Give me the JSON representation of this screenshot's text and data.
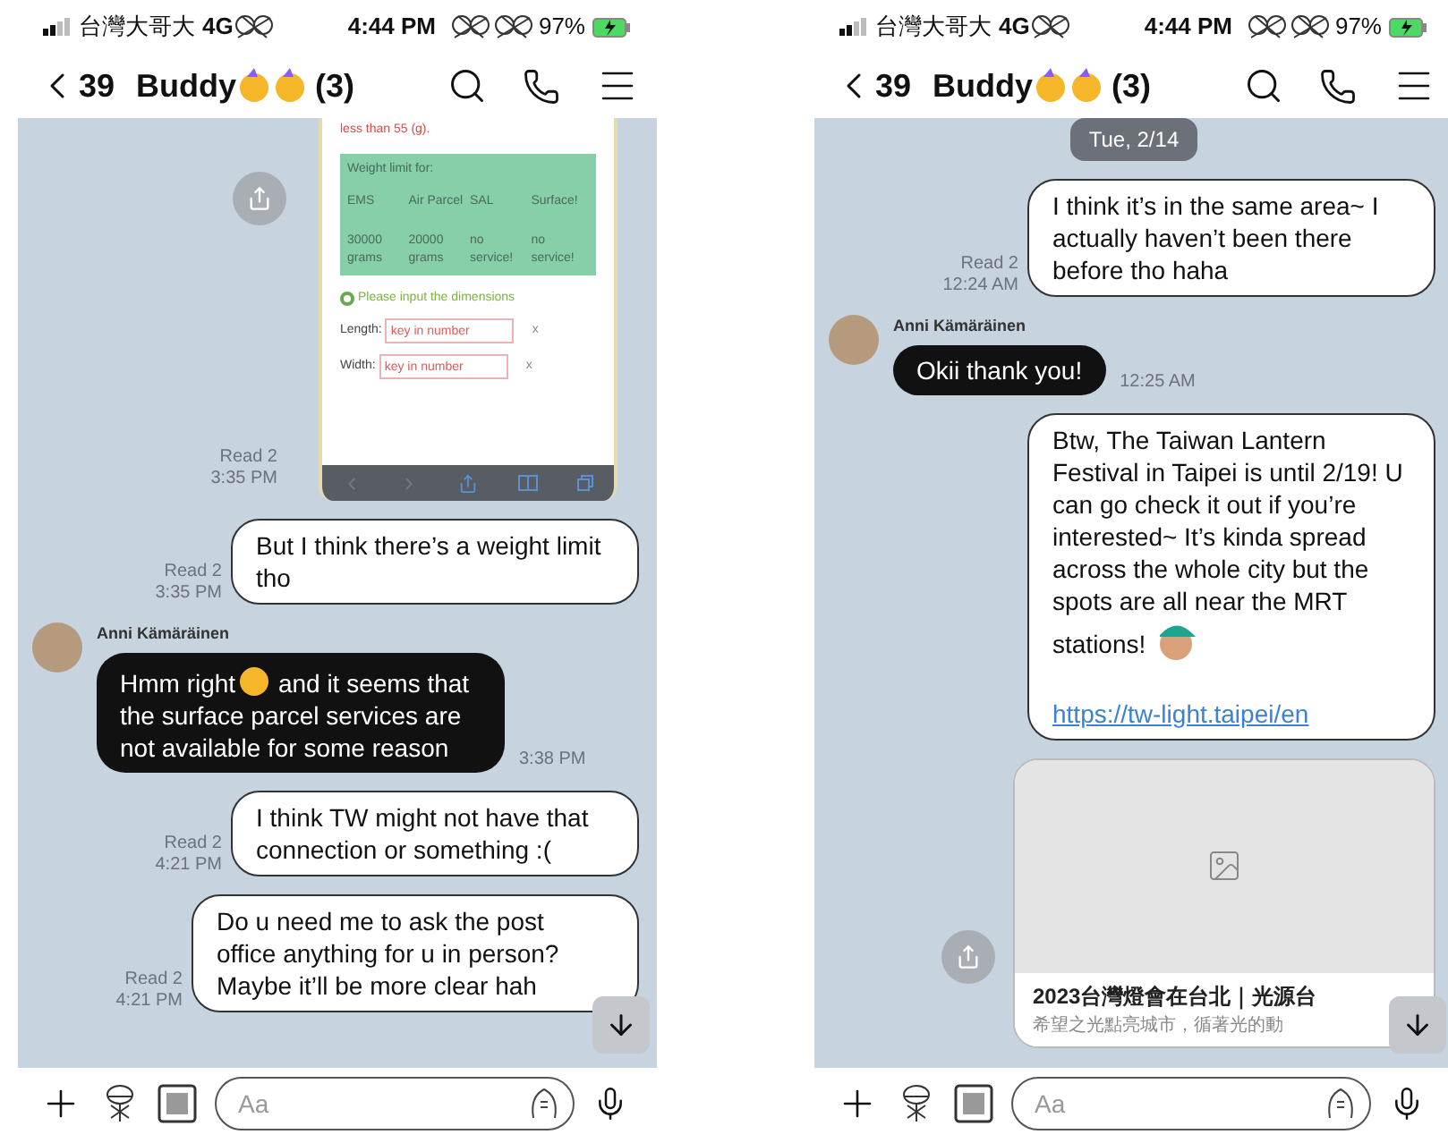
{
  "screens": [
    {
      "status_bar": {
        "carrier": "台灣大哥大",
        "network": "4G",
        "time": "4:44 PM",
        "battery": "97%"
      },
      "header": {
        "back_count": "39",
        "title": "Buddy",
        "member_count": "(3)"
      },
      "messages": [
        {
          "kind": "web_card",
          "note": "less than 55 (g).",
          "table_title": "Weight limit for:",
          "columns": [
            "EMS",
            "Air Parcel",
            "SAL",
            "Surface!"
          ],
          "row": [
            "30000 grams",
            "20000 grams",
            "no service!",
            "no service!"
          ],
          "prompt": "Please input the dimensions",
          "fields": [
            {
              "label": "Length:",
              "placeholder": "key in number",
              "unit": "x"
            },
            {
              "label": "Width:",
              "placeholder": "key in number",
              "unit": "x"
            }
          ],
          "read": "Read 2",
          "time": "3:35 PM"
        },
        {
          "kind": "outgoing",
          "text": [
            "But I think there’s a weight limit tho"
          ],
          "read": "Read 2",
          "time": "3:35 PM"
        },
        {
          "kind": "incoming",
          "sender": "Anni Kämäräinen",
          "text": [
            "Hmm right",
            " and it seems that the surface parcel services are not available for some reason"
          ],
          "time": "3:38 PM"
        },
        {
          "kind": "outgoing",
          "text": [
            "I think TW might not have that connection or something :("
          ],
          "read": "Read 2",
          "time": "4:21 PM"
        },
        {
          "kind": "outgoing",
          "text": [
            "Do u need me to ask the post office anything for u in person? Maybe it’ll be more clear hah"
          ],
          "read": "Read 2",
          "time": "4:21 PM"
        }
      ],
      "composer": {
        "placeholder": "Aa"
      }
    },
    {
      "status_bar": {
        "carrier": "台灣大哥大",
        "network": "4G",
        "time": "4:44 PM",
        "battery": "97%"
      },
      "header": {
        "back_count": "39",
        "title": "Buddy",
        "member_count": "(3)"
      },
      "messages": [
        {
          "kind": "date",
          "text": "Tue, 2/14"
        },
        {
          "kind": "outgoing",
          "text": [
            "I think it’s in the same area~ I actually haven’t been there before tho haha"
          ],
          "read": "Read 2",
          "time": "12:24 AM"
        },
        {
          "kind": "incoming",
          "sender": "Anni Kämäräinen",
          "text": [
            "Okii thank you!"
          ],
          "time": "12:25 AM"
        },
        {
          "kind": "outgoing",
          "text": [
            "Btw, The Taiwan Lantern Festival in Taipei is until 2/19! U can go check it out if you’re interested~ It’s kinda spread across the whole city but the spots are all near the MRT stations!"
          ],
          "sticker": true,
          "link": "https://tw-light.taipei/en"
        },
        {
          "kind": "link_preview",
          "title": "2023台灣燈會在台北｜光源台",
          "subtitle": "希望之光點亮城市，循著光的動"
        }
      ],
      "composer": {
        "placeholder": "Aa"
      }
    }
  ]
}
